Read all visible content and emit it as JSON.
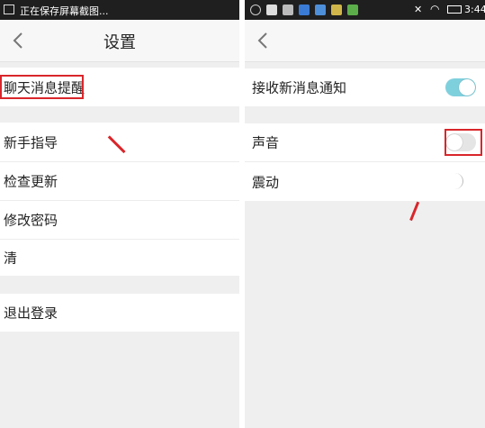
{
  "left": {
    "status_text": "正在保存屏幕截图...",
    "title": "设置",
    "items": [
      {
        "label": "聊天消息提醒"
      },
      {
        "label": "新手指导"
      },
      {
        "label": "检查更新"
      },
      {
        "label": "修改密码"
      },
      {
        "label": "清"
      },
      {
        "label": "退出登录"
      }
    ]
  },
  "right": {
    "time": "3:44",
    "settings": [
      {
        "label": "接收新消息通知",
        "enabled": true
      },
      {
        "label": "声音",
        "enabled": false
      },
      {
        "label": "震动",
        "enabled": false
      }
    ]
  },
  "colors": {
    "toggle_on": "#7fd0dd",
    "toggle_off": "#e5e5e5",
    "highlight": "#d9262b"
  }
}
